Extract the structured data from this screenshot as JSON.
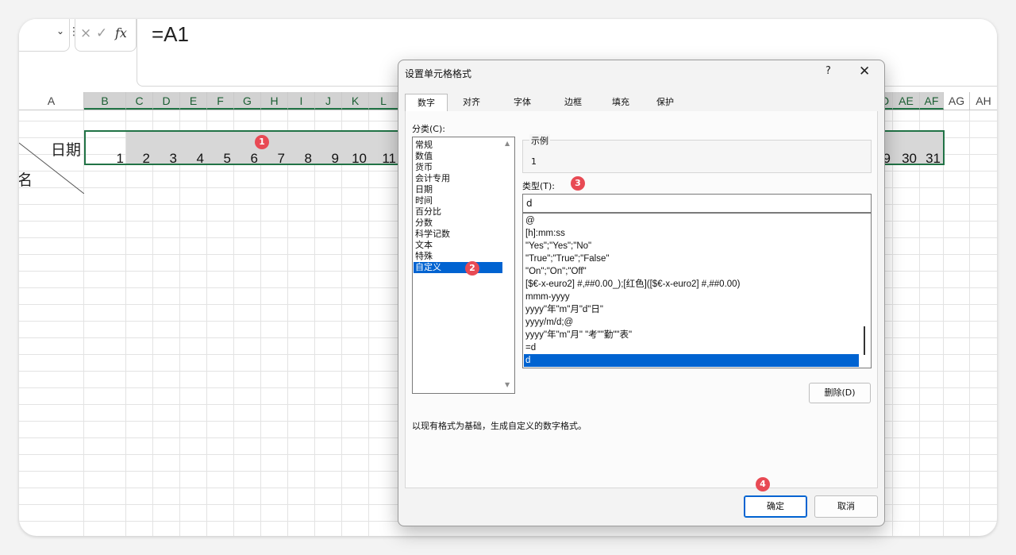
{
  "formula_bar": {
    "formula": "=A1",
    "cancel_glyph": "×",
    "confirm_glyph": "✓",
    "fx_label": "fx"
  },
  "columns": [
    {
      "label": "A",
      "selected": false
    },
    {
      "label": "B",
      "selected": true
    },
    {
      "label": "C",
      "selected": true
    },
    {
      "label": "D",
      "selected": true
    },
    {
      "label": "E",
      "selected": true
    },
    {
      "label": "F",
      "selected": true
    },
    {
      "label": "G",
      "selected": true
    },
    {
      "label": "H",
      "selected": true
    },
    {
      "label": "I",
      "selected": true
    },
    {
      "label": "J",
      "selected": true
    },
    {
      "label": "K",
      "selected": true
    },
    {
      "label": "L",
      "selected": true
    },
    {
      "label": "D",
      "selected": true
    },
    {
      "label": "AE",
      "selected": true
    },
    {
      "label": "AF",
      "selected": true
    },
    {
      "label": "AG",
      "selected": false
    },
    {
      "label": "AH",
      "selected": false
    }
  ],
  "sheet": {
    "header_date_label": "日期",
    "header_name_label": "名",
    "day_numbers_left": [
      "1",
      "2",
      "3",
      "4",
      "5",
      "6",
      "7",
      "8",
      "9",
      "10",
      "11"
    ],
    "day_numbers_right": [
      "9",
      "30",
      "31"
    ]
  },
  "markers": [
    "1",
    "2",
    "3",
    "4"
  ],
  "dialog": {
    "title": "设置单元格格式",
    "help": "?",
    "close": "✕",
    "tabs": [
      {
        "label": "数字",
        "active": true
      },
      {
        "label": "对齐",
        "active": false
      },
      {
        "label": "字体",
        "active": false
      },
      {
        "label": "边框",
        "active": false
      },
      {
        "label": "填充",
        "active": false
      },
      {
        "label": "保护",
        "active": false
      }
    ],
    "category_label": "分类(C):",
    "categories": [
      {
        "label": "常规",
        "selected": false
      },
      {
        "label": "数值",
        "selected": false
      },
      {
        "label": "货币",
        "selected": false
      },
      {
        "label": "会计专用",
        "selected": false
      },
      {
        "label": "日期",
        "selected": false
      },
      {
        "label": "时间",
        "selected": false
      },
      {
        "label": "百分比",
        "selected": false
      },
      {
        "label": "分数",
        "selected": false
      },
      {
        "label": "科学记数",
        "selected": false
      },
      {
        "label": "文本",
        "selected": false
      },
      {
        "label": "特殊",
        "selected": false
      },
      {
        "label": "自定义",
        "selected": true
      }
    ],
    "sample_label": "示例",
    "sample_value": "1",
    "type_label": "类型(T):",
    "type_value": "d",
    "formats": [
      {
        "label": "@",
        "selected": false
      },
      {
        "label": "[h]:mm:ss",
        "selected": false
      },
      {
        "label": "\"Yes\";\"Yes\";\"No\"",
        "selected": false
      },
      {
        "label": "\"True\";\"True\";\"False\"",
        "selected": false
      },
      {
        "label": "\"On\";\"On\";\"Off\"",
        "selected": false
      },
      {
        "label": "[$€-x-euro2] #,##0.00_);[红色]([$€-x-euro2] #,##0.00)",
        "selected": false
      },
      {
        "label": "mmm-yyyy",
        "selected": false
      },
      {
        "label": "yyyy\"年\"m\"月\"d\"日\"",
        "selected": false
      },
      {
        "label": "yyyy/m/d;@",
        "selected": false
      },
      {
        "label": "yyyy\"年\"m\"月\" \"考\"\"勤\"\"表\"",
        "selected": false
      },
      {
        "label": "=d",
        "selected": false
      },
      {
        "label": "d",
        "selected": true
      }
    ],
    "delete_button": "删除(D)",
    "description": "以现有格式为基础，生成自定义的数字格式。",
    "ok_button": "确定",
    "cancel_button": "取消"
  }
}
